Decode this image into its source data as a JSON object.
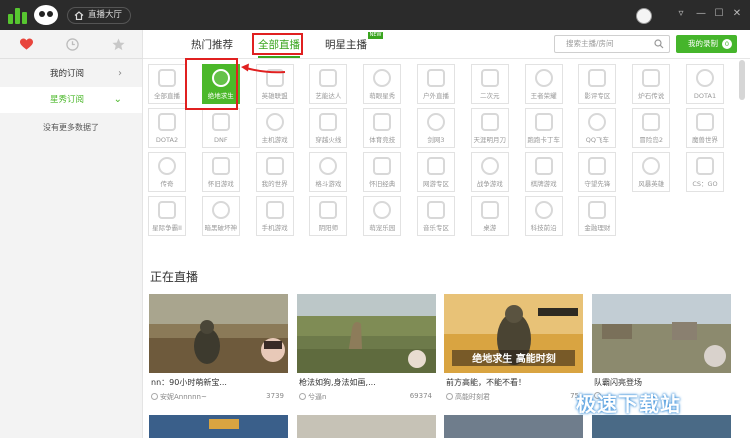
{
  "titlebar": {
    "hall_label": "直播大厅",
    "icons": [
      "home-icon",
      "avatar",
      "menu-icon",
      "minimize-icon",
      "maximize-icon",
      "close-icon"
    ],
    "controls": [
      "▿",
      "—",
      "☐",
      "✕"
    ]
  },
  "sidebar": {
    "tabs": [
      "heart-icon",
      "clock-icon",
      "star-icon"
    ],
    "active_color": "#e8453c",
    "items": [
      {
        "label": "我的订阅",
        "chevron": "›"
      },
      {
        "label": "星秀订阅",
        "chevron": "⌄"
      }
    ],
    "note": "没有更多数据了"
  },
  "nav": {
    "tabs": [
      "热门推荐",
      "全部直播",
      "明星主播"
    ],
    "active": "全部直播",
    "new_badge": "NEW",
    "search_placeholder": "搜索主播/房间",
    "record_label": "我的录制",
    "record_count": "0",
    "accent": "#45b52b"
  },
  "categories": [
    {
      "label": "全部直播"
    },
    {
      "label": "绝地求生"
    },
    {
      "label": "英雄联盟"
    },
    {
      "label": "艺能达人"
    },
    {
      "label": "萌眼星秀"
    },
    {
      "label": "户外直播"
    },
    {
      "label": "二次元"
    },
    {
      "label": "王者荣耀"
    },
    {
      "label": "影评专区"
    },
    {
      "label": "炉石传说"
    },
    {
      "label": "DOTA1"
    },
    {
      "label": "DOTA2"
    },
    {
      "label": "DNF"
    },
    {
      "label": "主机游戏"
    },
    {
      "label": "穿越火线"
    },
    {
      "label": "体育竞技"
    },
    {
      "label": "剑网3"
    },
    {
      "label": "天涯明月刀"
    },
    {
      "label": "跑跑卡丁车"
    },
    {
      "label": "QQ飞车"
    },
    {
      "label": "冒险岛2"
    },
    {
      "label": "魔兽世界"
    },
    {
      "label": "传奇"
    },
    {
      "label": "怀旧游戏"
    },
    {
      "label": "我的世界"
    },
    {
      "label": "格斗游戏"
    },
    {
      "label": "怀旧经典"
    },
    {
      "label": "网游专区"
    },
    {
      "label": "战争游戏"
    },
    {
      "label": "棋牌游戏"
    },
    {
      "label": "守望先锋"
    },
    {
      "label": "风暴英雄"
    },
    {
      "label": "CS：GO"
    },
    {
      "label": "星际争霸II"
    },
    {
      "label": "暗黑破坏神"
    },
    {
      "label": "手机游戏"
    },
    {
      "label": "阴阳师"
    },
    {
      "label": "萌宠乐园"
    },
    {
      "label": "音乐专区"
    },
    {
      "label": "桌游"
    },
    {
      "label": "科技前沿"
    },
    {
      "label": "金融理财"
    }
  ],
  "selected_category": "绝地求生",
  "section_title": "正在直播",
  "streams": [
    {
      "title": "nn：90小时萌新宝...",
      "user": "安妮Annnnn~",
      "viewers": "3739"
    },
    {
      "title": "枪法如狗,身法如画,...",
      "user": "兮逼n",
      "viewers": "69374"
    },
    {
      "title": "前方高能，不能不看！",
      "user": "高能时刻君",
      "viewers": "75"
    },
    {
      "title": "队霸闪亮登场",
      "user": "",
      "viewers": ""
    }
  ],
  "thumb_overlay": "绝地求生 高能时刻",
  "watermark": "极速下载站"
}
